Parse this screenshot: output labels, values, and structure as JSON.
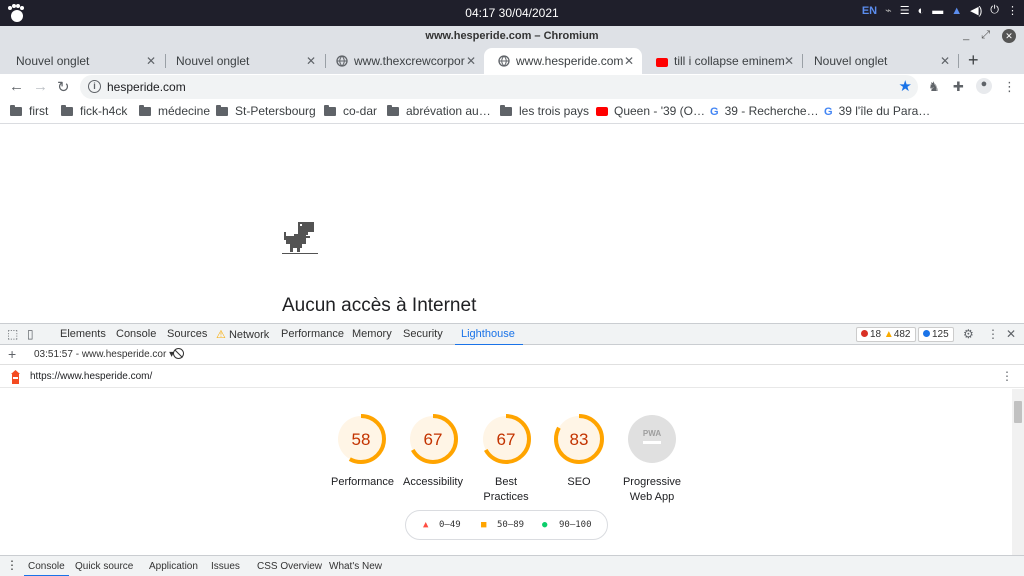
{
  "system": {
    "clock": "04:17  30/04/2021",
    "lang": "EN"
  },
  "window": {
    "title": "www.hesperide.com – Chromium"
  },
  "tabs": [
    {
      "label": "Nouvel onglet",
      "favicon": "none"
    },
    {
      "label": "Nouvel onglet",
      "favicon": "none"
    },
    {
      "label": "www.thexcrewcorpor",
      "favicon": "globe-icon"
    },
    {
      "label": "www.hesperide.com",
      "favicon": "globe-icon",
      "active": true
    },
    {
      "label": "till i collapse eminem",
      "favicon": "youtube-icon"
    },
    {
      "label": "Nouvel onglet",
      "favicon": "none"
    }
  ],
  "omnibox": {
    "url": "hesperide.com"
  },
  "bookmarks": [
    {
      "label": "first",
      "icon": "folder-icon"
    },
    {
      "label": "fick-h4ck",
      "icon": "folder-icon"
    },
    {
      "label": "médecine",
      "icon": "folder-icon"
    },
    {
      "label": "St-Petersbourg",
      "icon": "folder-icon"
    },
    {
      "label": "co-dar",
      "icon": "folder-icon"
    },
    {
      "label": "abrévation au…",
      "icon": "folder-icon"
    },
    {
      "label": "les trois pays",
      "icon": "folder-icon"
    },
    {
      "label": "Queen - '39 (O…",
      "icon": "youtube-icon"
    },
    {
      "label": "39 - Recherche…",
      "icon": "google-icon"
    },
    {
      "label": "39 l'île du Para…",
      "icon": "google-icon"
    }
  ],
  "page": {
    "message": "Aucun accès à Internet"
  },
  "devtools": {
    "tabs": [
      "Elements",
      "Console",
      "Sources",
      "Network",
      "Performance",
      "Memory",
      "Security",
      "Lighthouse"
    ],
    "active_tab": "Lighthouse",
    "errors": "18",
    "warnings": "482",
    "info": "125",
    "report_select": "03:51:57 - www.hesperide.cor",
    "report_url": "https://www.hesperide.com/",
    "pwa_badge": "PWA"
  },
  "scores": [
    {
      "label": "Performance",
      "value": "58",
      "fraction": 0.58
    },
    {
      "label": "Accessibility",
      "value": "67",
      "fraction": 0.67
    },
    {
      "label": "Best Practices",
      "value": "67",
      "fraction": 0.67
    },
    {
      "label": "SEO",
      "value": "83",
      "fraction": 0.83
    },
    {
      "label": "Progressive Web App",
      "value": "",
      "fraction": 0
    }
  ],
  "legend": {
    "fail": "0–49",
    "average": "50–89",
    "pass": "90–100"
  },
  "drawer_tabs": [
    "Console",
    "Quick source",
    "Application",
    "Issues",
    "CSS Overview",
    "What's New"
  ],
  "colors": {
    "average": "#ffa400",
    "average_bg": "#fff5e6",
    "fail": "#ff4e42",
    "pass": "#0cce6b",
    "accent": "#1a73e8"
  }
}
